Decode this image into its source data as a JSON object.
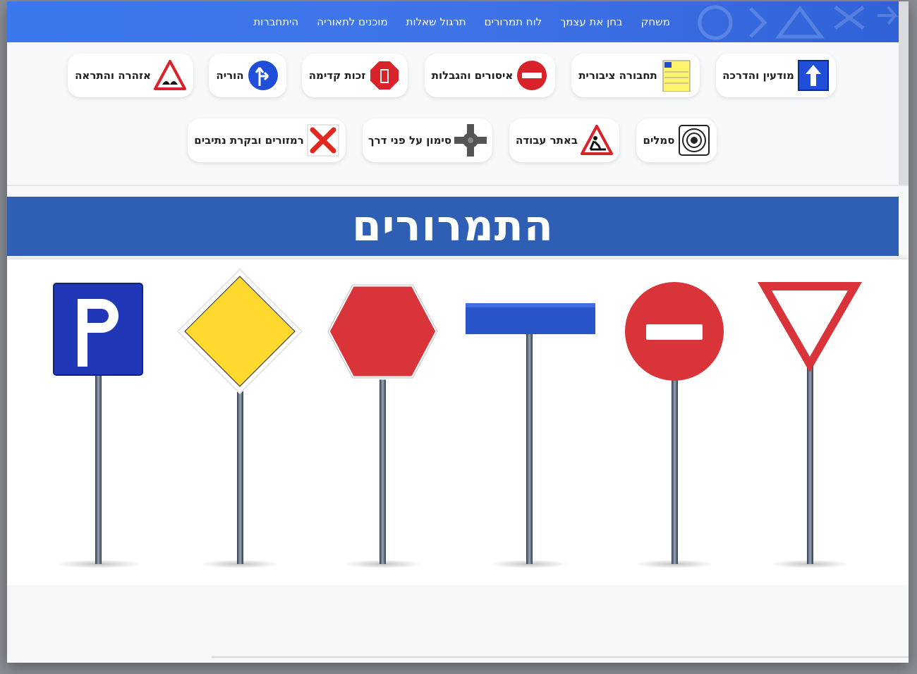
{
  "nav": {
    "links": [
      "משחק",
      "בחן את עצמך",
      "לוח תמרורים",
      "תרגול שאלות",
      "מוכנים לתאוריה",
      "היתחברות"
    ]
  },
  "categories": {
    "row1": [
      {
        "label": "מודעין והדרכה",
        "icon": "arrow-up-sign-icon"
      },
      {
        "label": "תחבורה ציבורית",
        "icon": "bus-stop-sign-icon"
      },
      {
        "label": "איסורים והגבלות",
        "icon": "no-entry-sign-icon"
      },
      {
        "label": "זכות קדימה",
        "icon": "stop-sign-icon"
      },
      {
        "label": "הוריה",
        "icon": "direction-sign-icon"
      },
      {
        "label": "אזהרה והתראה",
        "icon": "warning-triangle-icon"
      }
    ],
    "row2": [
      {
        "label": "סמלים",
        "icon": "target-symbol-icon"
      },
      {
        "label": "באתר עבודה",
        "icon": "roadwork-sign-icon"
      },
      {
        "label": "סימון על פני דרך",
        "icon": "roundabout-marking-icon"
      },
      {
        "label": "רמזורים ובקרת נתיבים",
        "icon": "red-x-lane-icon"
      }
    ]
  },
  "hero": {
    "title": "התמרורים"
  },
  "colors": {
    "nav": "#3a78ee",
    "band": "#2f5fb5",
    "sign_red": "#d32f2f",
    "sign_blue": "#2a4bc8",
    "sign_yellow": "#ffd700"
  },
  "signs": [
    "yield-sign-icon",
    "no-entry-sign-icon",
    "blank-blue-sign-icon",
    "stop-octagon-sign-icon",
    "priority-road-sign-icon",
    "parking-sign-icon"
  ]
}
